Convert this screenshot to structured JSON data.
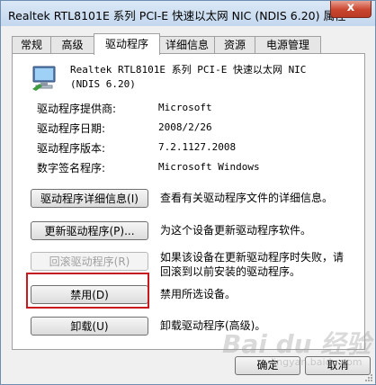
{
  "window": {
    "title": "Realtek RTL8101E 系列 PCI-E 快速以太网 NIC (NDIS 6.20) 属性",
    "close_glyph": "x"
  },
  "tabs": [
    {
      "label": "常规",
      "active": false
    },
    {
      "label": "高级",
      "active": false
    },
    {
      "label": "驱动程序",
      "active": true
    },
    {
      "label": "详细信息",
      "active": false
    },
    {
      "label": "资源",
      "active": false
    },
    {
      "label": "电源管理",
      "active": false
    }
  ],
  "device": {
    "icon": "network-adapter-icon",
    "name_line1": "Realtek RTL8101E 系列 PCI-E 快速以太网 NIC",
    "name_line2": "(NDIS 6.20)"
  },
  "properties": [
    {
      "label": "驱动程序提供商:",
      "value": "Microsoft"
    },
    {
      "label": "驱动程序日期:",
      "value": "2008/2/26"
    },
    {
      "label": "驱动程序版本:",
      "value": "7.2.1127.2008"
    },
    {
      "label": "数字签名程序:",
      "value": "Microsoft Windows"
    }
  ],
  "actions": [
    {
      "button": "驱动程序详细信息(I)",
      "desc": "查看有关驱动程序文件的详细信息。",
      "enabled": true
    },
    {
      "button": "更新驱动程序(P)...",
      "desc": "为这个设备更新驱动程序软件。",
      "enabled": true
    },
    {
      "button": "回滚驱动程序(R)",
      "desc_line1": "如果该设备在更新驱动程序时失败，请",
      "desc_line2": "回滚到以前安装的驱动程序。",
      "enabled": false
    },
    {
      "button": "禁用(D)",
      "desc": "禁用所选设备。",
      "enabled": true
    },
    {
      "button": "卸载(U)",
      "desc": "卸载驱动程序(高级)。",
      "enabled": true
    }
  ],
  "footer": {
    "ok_label": "确定",
    "cancel_label": "取消"
  },
  "watermark": {
    "text": "Bai du 经验",
    "sub": "jingyan.baidu.com"
  },
  "colors": {
    "highlight": "#c8191e",
    "titlebar": "#c3d7ee",
    "close": "#c9452e"
  }
}
